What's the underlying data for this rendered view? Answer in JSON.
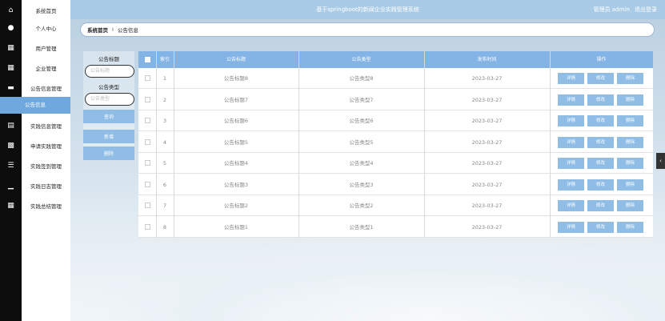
{
  "header": {
    "title": "基于springboot的新闻企业实践管理系统",
    "user_text": "管理员 admin",
    "logout": "退出登录"
  },
  "sidebar": {
    "items": [
      {
        "label": "系统首页",
        "icon": "home-icon"
      },
      {
        "label": "个人中心",
        "icon": "user-icon"
      },
      {
        "label": "用户管理",
        "icon": "grid-icon"
      },
      {
        "label": "企业管理",
        "icon": "grid-icon"
      },
      {
        "label": "公告信息管理",
        "icon": "monitor-icon"
      },
      {
        "label": "公告信息",
        "icon": "",
        "active": true
      },
      {
        "label": "实践信息管理",
        "icon": "list-icon"
      },
      {
        "label": "申请实践管理",
        "icon": "ticket-icon"
      },
      {
        "label": "实践签到管理",
        "icon": "menu-icon"
      },
      {
        "label": "实践日志管理",
        "icon": "chart-icon"
      },
      {
        "label": "实践总结管理",
        "icon": "grid-icon"
      }
    ]
  },
  "breadcrumb": {
    "home": "系统首页",
    "separator": "I",
    "current": "公告信息"
  },
  "filter": {
    "title_label": "公告标题",
    "title_placeholder": "公告标题",
    "type_label": "公告类型",
    "type_placeholder": "公告类型",
    "search_button": "查询",
    "add_button": "新增",
    "delete_button": "删除"
  },
  "table": {
    "headers": [
      "索引",
      "公告标题",
      "公告类型",
      "发布时间",
      "操作"
    ],
    "rows": [
      {
        "index": "1",
        "title": "公告标题8",
        "type": "公告类型8",
        "date": "2023-03-27"
      },
      {
        "index": "2",
        "title": "公告标题7",
        "type": "公告类型7",
        "date": "2023-03-27"
      },
      {
        "index": "3",
        "title": "公告标题6",
        "type": "公告类型6",
        "date": "2023-03-27"
      },
      {
        "index": "4",
        "title": "公告标题5",
        "type": "公告类型5",
        "date": "2023-03-27"
      },
      {
        "index": "5",
        "title": "公告标题4",
        "type": "公告类型4",
        "date": "2023-03-27"
      },
      {
        "index": "6",
        "title": "公告标题3",
        "type": "公告类型3",
        "date": "2023-03-27"
      },
      {
        "index": "7",
        "title": "公告标题2",
        "type": "公告类型2",
        "date": "2023-03-27"
      },
      {
        "index": "8",
        "title": "公告标题1",
        "type": "公告类型1",
        "date": "2023-03-27"
      }
    ],
    "action_labels": {
      "detail": "详情",
      "edit": "修改",
      "delete": "删除"
    }
  },
  "colors": {
    "header": "#a9cbe6",
    "active_menu": "#6fa8dc",
    "table_header": "#84b3e6",
    "button": "#8fbde6"
  }
}
